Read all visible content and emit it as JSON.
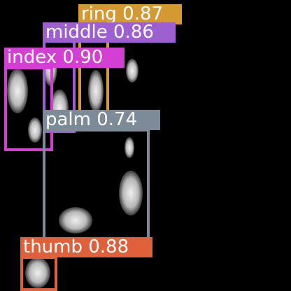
{
  "image": {
    "background_color": "#000000"
  },
  "detections": [
    {
      "label": "ring 0.87",
      "class": "ring",
      "confidence": 0.87,
      "color": "#d49a31"
    },
    {
      "label": "middle 0.86",
      "class": "middle",
      "confidence": 0.86,
      "color": "#9e5fd0"
    },
    {
      "label": "index 0.90",
      "class": "index",
      "confidence": 0.9,
      "color": "#d43fd3"
    },
    {
      "label": "palm 0.74",
      "class": "palm",
      "confidence": 0.74,
      "color": "#7d8a97"
    },
    {
      "label": "thumb 0.88",
      "class": "thumb",
      "confidence": 0.88,
      "color": "#e0603a"
    }
  ]
}
